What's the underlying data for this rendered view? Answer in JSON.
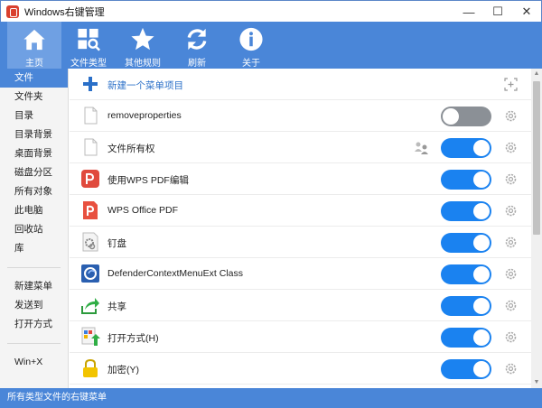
{
  "window": {
    "title": "Windows右键管理",
    "min": "—",
    "max": "☐",
    "close": "✕"
  },
  "toolbar": {
    "items": [
      {
        "label": "主页",
        "icon": "home-icon"
      },
      {
        "label": "文件类型",
        "icon": "file-types-icon"
      },
      {
        "label": "其他规则",
        "icon": "star-icon"
      },
      {
        "label": "刷新",
        "icon": "refresh-icon"
      },
      {
        "label": "关于",
        "icon": "info-icon"
      }
    ],
    "active": "主页"
  },
  "sidebar": {
    "group1": [
      "文件",
      "文件夹",
      "目录",
      "目录背景",
      "桌面背景",
      "磁盘分区",
      "所有对象",
      "此电脑",
      "回收站",
      "库"
    ],
    "group2": [
      "新建菜单",
      "发送到",
      "打开方式"
    ],
    "group3": [
      "Win+X"
    ],
    "selected": "文件"
  },
  "main": {
    "new_item": "新建一个菜单项目",
    "rows": [
      {
        "label": "removeproperties",
        "icon": "blank-file-icon",
        "enabled": false
      },
      {
        "label": "文件所有权",
        "icon": "blank-file-icon",
        "enabled": true
      },
      {
        "label": "使用WPS PDF编辑",
        "icon": "wps-pdf-icon",
        "enabled": true
      },
      {
        "label": "WPS Office PDF",
        "icon": "wps-office-pdf-icon",
        "enabled": true
      },
      {
        "label": "钉盘",
        "icon": "dingpan-icon",
        "enabled": true
      },
      {
        "label": "DefenderContextMenuExt Class",
        "icon": "defender-icon",
        "enabled": true
      },
      {
        "label": "共享",
        "icon": "share-icon",
        "enabled": true
      },
      {
        "label": "打开方式(H)",
        "icon": "open-with-icon",
        "enabled": true
      },
      {
        "label": "加密(Y)",
        "icon": "lock-icon",
        "enabled": true
      }
    ]
  },
  "status": {
    "text": "所有类型文件的右键菜单"
  },
  "colors": {
    "accent": "#4a86d8",
    "toggle_on": "#1a82f0",
    "toggle_off": "#8b9096"
  }
}
